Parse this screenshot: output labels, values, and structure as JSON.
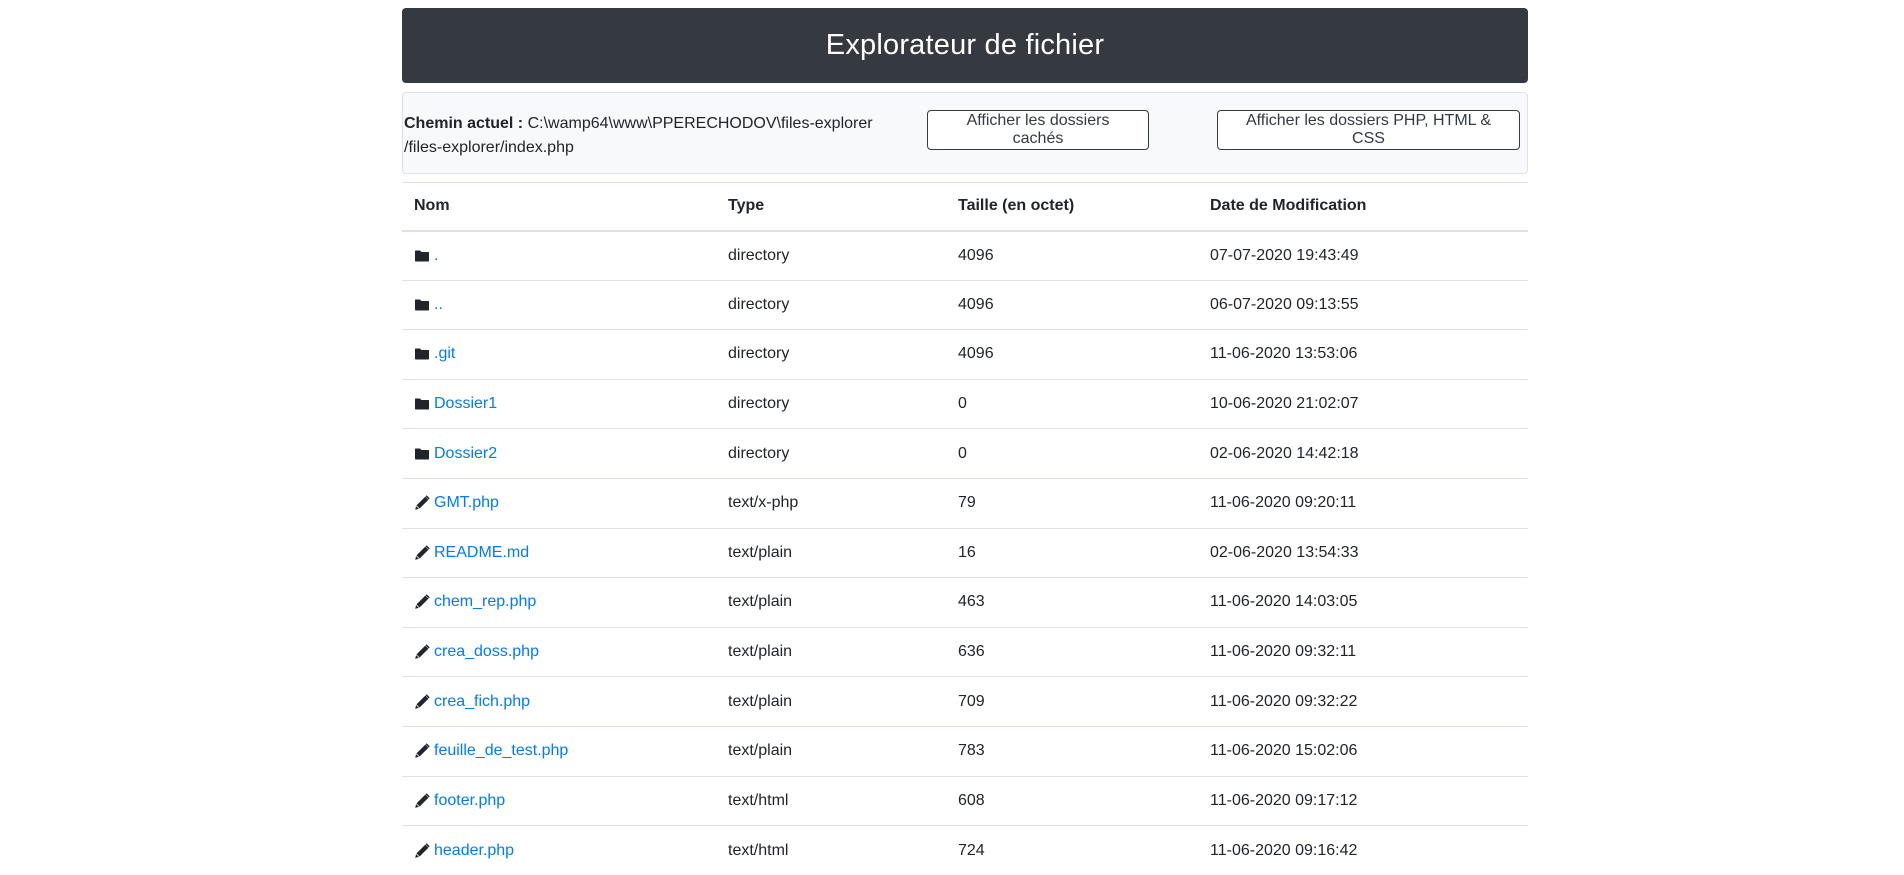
{
  "header": {
    "title": "Explorateur de fichier"
  },
  "info_bar": {
    "path_label": "Chemin actuel :",
    "path_value_line1": "C:\\wamp64\\www\\PPERECHODOV\\files-explorer",
    "path_value_line2": "/files-explorer/index.php",
    "show_hidden_button": "Afficher les dossiers cachés",
    "show_php_button": "Afficher les dossiers PHP, HTML & CSS"
  },
  "table": {
    "columns": [
      "Nom",
      "Type",
      "Taille (en octet)",
      "Date de Modification"
    ],
    "rows": [
      {
        "name": ".",
        "icon": "folder-icon",
        "type": "directory",
        "size": "4096",
        "date": "07-07-2020 19:43:49"
      },
      {
        "name": "..",
        "icon": "folder-icon",
        "type": "directory",
        "size": "4096",
        "date": "06-07-2020 09:13:55"
      },
      {
        "name": ".git",
        "icon": "folder-icon",
        "type": "directory",
        "size": "4096",
        "date": "11-06-2020 13:53:06"
      },
      {
        "name": "Dossier1",
        "icon": "folder-icon",
        "type": "directory",
        "size": "0",
        "date": "10-06-2020 21:02:07"
      },
      {
        "name": "Dossier2",
        "icon": "folder-icon",
        "type": "directory",
        "size": "0",
        "date": "02-06-2020 14:42:18"
      },
      {
        "name": "GMT.php",
        "icon": "pencil-icon",
        "type": "text/x-php",
        "size": "79",
        "date": "11-06-2020 09:20:11"
      },
      {
        "name": "README.md",
        "icon": "pencil-icon",
        "type": "text/plain",
        "size": "16",
        "date": "02-06-2020 13:54:33"
      },
      {
        "name": "chem_rep.php",
        "icon": "pencil-icon",
        "type": "text/plain",
        "size": "463",
        "date": "11-06-2020 14:03:05"
      },
      {
        "name": "crea_doss.php",
        "icon": "pencil-icon",
        "type": "text/plain",
        "size": "636",
        "date": "11-06-2020 09:32:11"
      },
      {
        "name": "crea_fich.php",
        "icon": "pencil-icon",
        "type": "text/plain",
        "size": "709",
        "date": "11-06-2020 09:32:22"
      },
      {
        "name": "feuille_de_test.php",
        "icon": "pencil-icon",
        "type": "text/plain",
        "size": "783",
        "date": "11-06-2020 15:02:06"
      },
      {
        "name": "footer.php",
        "icon": "pencil-icon",
        "type": "text/html",
        "size": "608",
        "date": "11-06-2020 09:17:12"
      },
      {
        "name": "header.php",
        "icon": "pencil-icon",
        "type": "text/html",
        "size": "724",
        "date": "11-06-2020 09:16:42"
      }
    ]
  },
  "colors": {
    "header_bg": "#343a40",
    "link": "#007bff",
    "info_bg": "#f8f9fa"
  }
}
